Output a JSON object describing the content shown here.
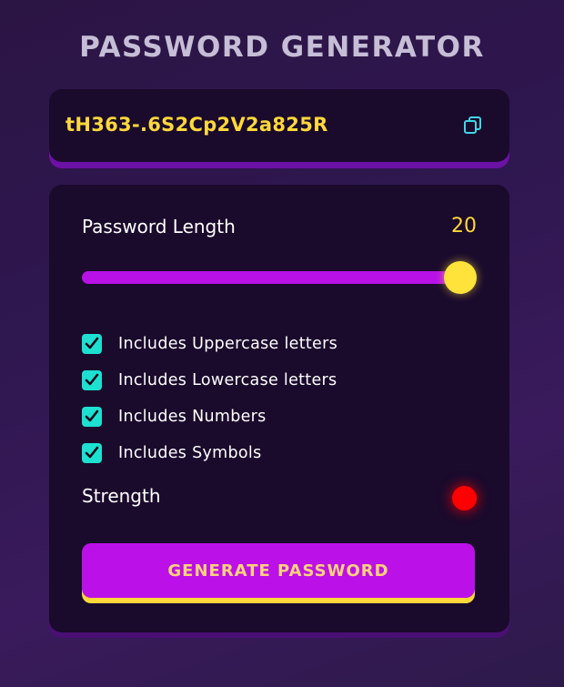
{
  "app": {
    "title": "PASSWORD GENERATOR"
  },
  "output": {
    "password": "tH363-.6S2Cp2V2a825R",
    "copy_icon": "copy-icon"
  },
  "length": {
    "label": "Password Length",
    "value": "20",
    "slider_fill_percent": 100
  },
  "options": [
    {
      "label": "Includes Uppercase letters",
      "checked": true
    },
    {
      "label": "Includes Lowercase letters",
      "checked": true
    },
    {
      "label": "Includes Numbers",
      "checked": true
    },
    {
      "label": "Includes Symbols",
      "checked": true
    }
  ],
  "strength": {
    "label": "Strength",
    "indicator_color": "#ff0000"
  },
  "generate": {
    "label": "GENERATE PASSWORD"
  },
  "colors": {
    "accent_yellow": "#ffd83a",
    "accent_purple": "#bb11e8",
    "checkbox_teal": "#1de0d0",
    "panel_bg": "#1a0a2c"
  }
}
